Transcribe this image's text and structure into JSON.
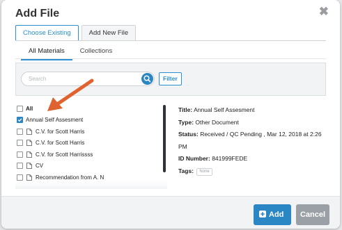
{
  "dialog": {
    "title": "Add File"
  },
  "tabs": [
    {
      "label": "Choose Existing"
    },
    {
      "label": "Add New File"
    }
  ],
  "subtabs": [
    {
      "label": "All Materials"
    },
    {
      "label": "Collections"
    }
  ],
  "search": {
    "placeholder": "Search",
    "filter_label": "Filter"
  },
  "files": {
    "all_label": "All",
    "items": [
      {
        "label": "Annual Self Assesment",
        "checked": true
      },
      {
        "label": "C.V. for Scott Harris",
        "checked": false
      },
      {
        "label": "C.V. for Scott Harris",
        "checked": false
      },
      {
        "label": "C.V. for Scott Harrissss",
        "checked": false
      },
      {
        "label": "CV",
        "checked": false
      },
      {
        "label": "Recommendation from A. N",
        "checked": false
      }
    ]
  },
  "details": {
    "title_label": "Title:",
    "title_value": "Annual Self Assesment",
    "type_label": "Type:",
    "type_value": "Other Document",
    "status_label": "Status:",
    "status_value": "Received / QC Pending , Mar 12, 2018 at 2:26 PM",
    "id_label": "ID Number:",
    "id_value": "841999FEDE",
    "tags_label": "Tags:",
    "tags_value": "None"
  },
  "footer": {
    "add_label": "Add",
    "cancel_label": "Cancel"
  },
  "colors": {
    "accent": "#2b86c4",
    "arrow": "#e0622f",
    "cancel": "#9aa0a5"
  },
  "icons": [
    "close-icon",
    "search-icon",
    "checkbox-icon",
    "document-icon",
    "plus-icon",
    "arrow-annotation-icon"
  ]
}
